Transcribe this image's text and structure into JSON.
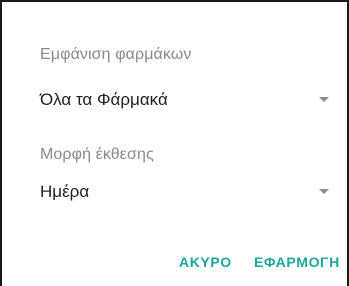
{
  "dialog": {
    "fields": [
      {
        "label": "Εμφάνιση φαρμάκων",
        "value": "Όλα τα Φάρμακά"
      },
      {
        "label": "Μορφή έκθεσης",
        "value": "Ημέρα"
      }
    ],
    "actions": {
      "cancel_label": "ΑΚΥΡΟ",
      "apply_label": "ΕΦΑΡΜΟΓΗ"
    },
    "icons": {
      "dropdown": "chevron-down-icon"
    },
    "colors": {
      "accent": "#1ca99b",
      "label": "#8a8a8a",
      "text": "#1f1f1f",
      "arrow": "#8c8c8c"
    }
  }
}
